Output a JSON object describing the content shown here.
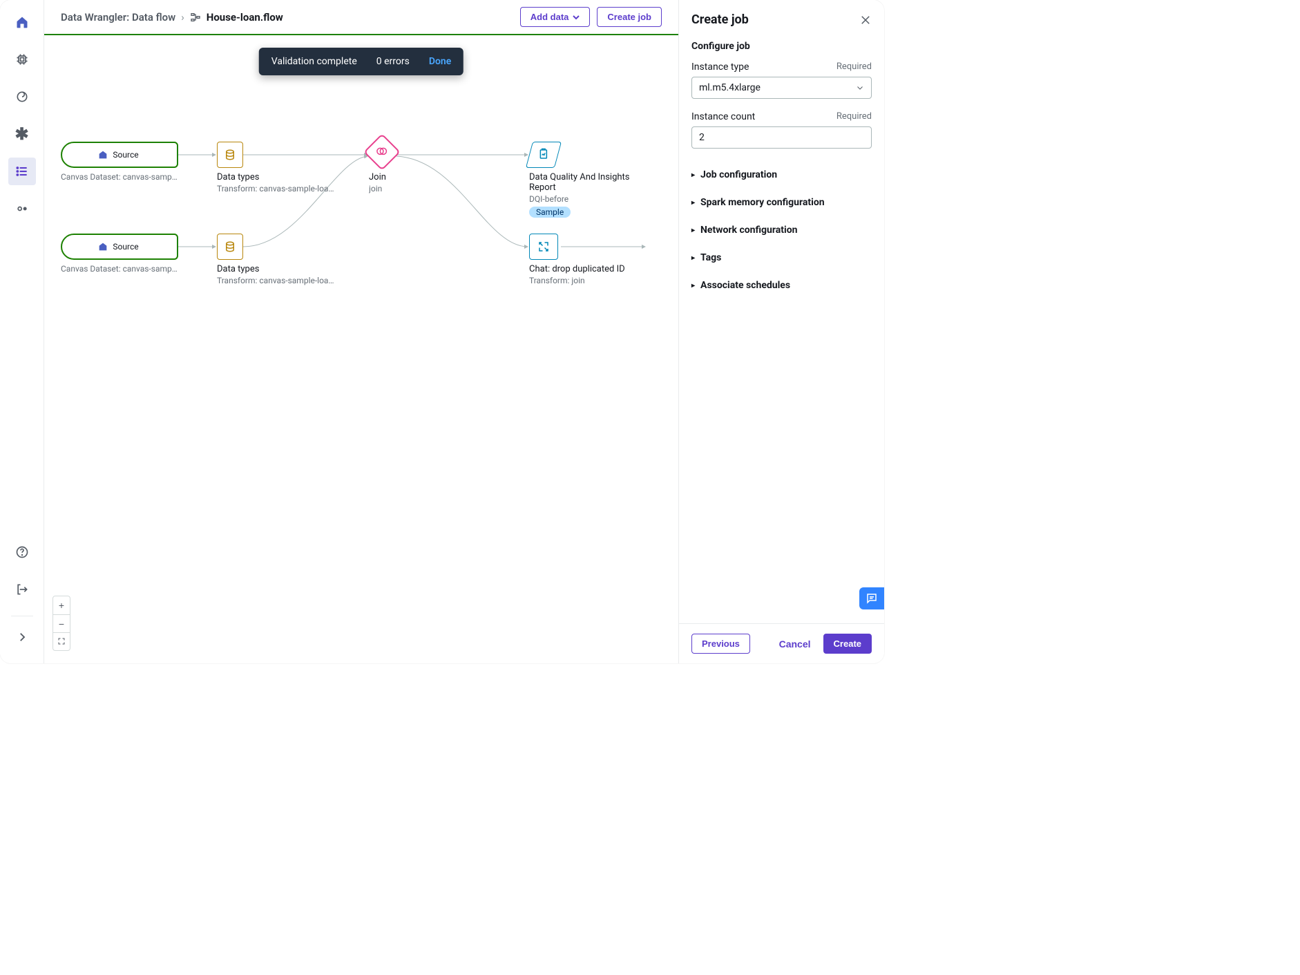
{
  "sidebar": {
    "items": [
      {
        "name": "home",
        "icon": "home"
      },
      {
        "name": "compute",
        "icon": "chip"
      },
      {
        "name": "pipelines",
        "icon": "pipeline"
      },
      {
        "name": "experiments",
        "icon": "asterisk"
      },
      {
        "name": "data-wrangler",
        "icon": "list",
        "active": true
      },
      {
        "name": "endpoints",
        "icon": "dots"
      }
    ],
    "footer": [
      {
        "name": "help",
        "icon": "help"
      },
      {
        "name": "logout",
        "icon": "logout"
      }
    ]
  },
  "breadcrumb": {
    "parent": "Data Wrangler: Data flow",
    "current": "House-loan.flow"
  },
  "header_buttons": {
    "add_data": "Add data",
    "create_job": "Create job"
  },
  "toast": {
    "message": "Validation complete",
    "errors": "0 errors",
    "done": "Done"
  },
  "flow": {
    "source1": {
      "label": "Source",
      "title": "Canvas Dataset: canvas-sample-loans-…"
    },
    "source2": {
      "label": "Source",
      "title": "Canvas Dataset: canvas-sample-loans-…"
    },
    "types1": {
      "title": "Data types",
      "sub": "Transform: canvas-sample-loans-part-…"
    },
    "types2": {
      "title": "Data types",
      "sub": "Transform: canvas-sample-loans-part-…"
    },
    "join": {
      "title": "Join",
      "sub": "join"
    },
    "report": {
      "title": "Data Quality And Insights Report",
      "sub": "DQI-before",
      "badge": "Sample"
    },
    "chat": {
      "title": "Chat: drop duplicated ID",
      "sub": "Transform: join"
    }
  },
  "panel": {
    "title": "Create job",
    "configure": "Configure job",
    "instance_type_label": "Instance type",
    "instance_type_value": "ml.m5.4xlarge",
    "instance_count_label": "Instance count",
    "instance_count_value": "2",
    "required": "Required",
    "sections": [
      "Job configuration",
      "Spark memory configuration",
      "Network configuration",
      "Tags",
      "Associate schedules"
    ],
    "footer": {
      "previous": "Previous",
      "cancel": "Cancel",
      "create": "Create"
    }
  }
}
